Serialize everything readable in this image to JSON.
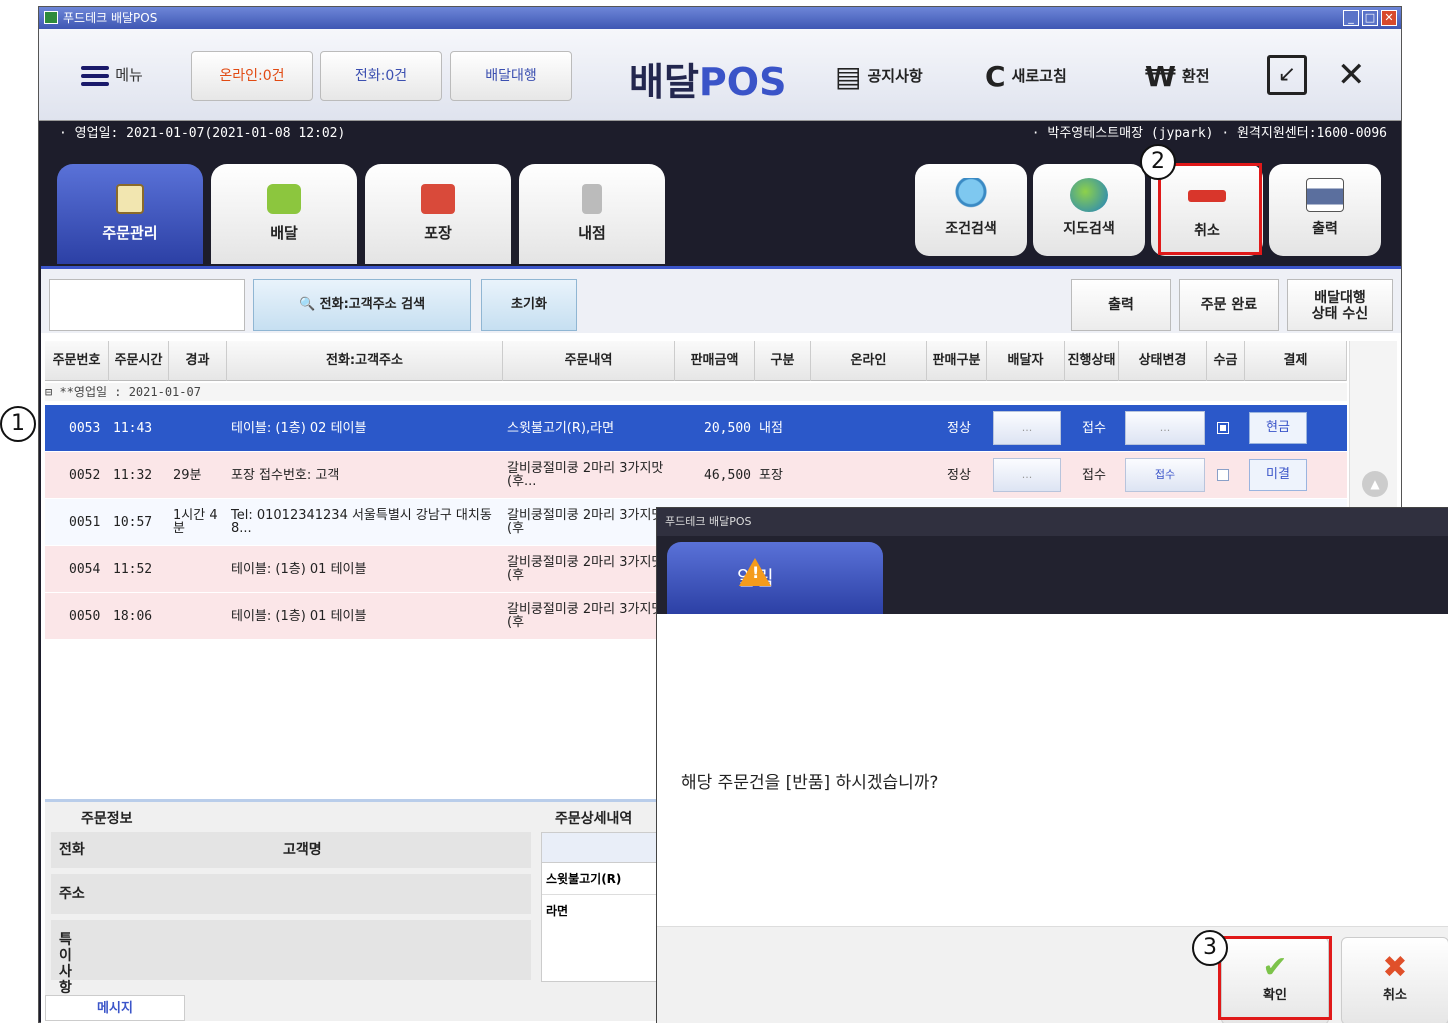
{
  "window": {
    "title": "푸드테크 배달POS"
  },
  "topbar": {
    "menu_label": "메뉴",
    "online_label": "온라인:0건",
    "phone_label": "전화:0건",
    "agent_label": "배달대행",
    "brand_prefix": "배달",
    "brand_suffix": "POS",
    "notice_label": "공지사항",
    "refresh_label": "새로고침",
    "exchange_label": "환전",
    "exchange_icon": "₩",
    "refresh_icon": "C"
  },
  "info": {
    "business_day": "· 영업일: 2021-01-07(2021-01-08 12:02)",
    "store": "· 박주영테스트매장 (jypark)  · 원격지원센터:1600-0096"
  },
  "tabs": [
    {
      "label": "주문관리"
    },
    {
      "label": "배달"
    },
    {
      "label": "포장"
    },
    {
      "label": "내점"
    }
  ],
  "tools": [
    {
      "label": "조건검색"
    },
    {
      "label": "지도검색"
    },
    {
      "label": "취소"
    },
    {
      "label": "출력"
    }
  ],
  "search": {
    "input_value": "",
    "search_button": "전화:고객주소 검색",
    "reset_button": "초기화",
    "print_button": "출력",
    "complete_button": "주문 완료",
    "agent_status_line1": "배달대행",
    "agent_status_line2": "상태 수신"
  },
  "grid": {
    "headers": [
      "주문번호",
      "주문시간",
      "경과",
      "전화:고객주소",
      "주문내역",
      "판매금액",
      "구분",
      "온라인",
      "판매구분",
      "배달자",
      "진행상태",
      "상태변경",
      "수금",
      "결제"
    ],
    "group_label": "⊟ **영업일 : 2021-01-07",
    "rows": [
      {
        "no": "0053",
        "time": "11:43",
        "elapsed": "",
        "addr": "테이블: (1층) 02 테이블",
        "items": "스윗불고기(R),라면",
        "amount": "20,500",
        "type": "내점",
        "online": "",
        "sale": "정상",
        "rider": "...",
        "status": "접수",
        "change": "...",
        "paid": true,
        "pay": "현금"
      },
      {
        "no": "0052",
        "time": "11:32",
        "elapsed": "29분",
        "addr": "포장 접수번호: 고객",
        "items": "갈비쿵절미쿵 2마리 3가지맛(후...",
        "amount": "46,500",
        "type": "포장",
        "online": "",
        "sale": "정상",
        "rider": "...",
        "status": "접수",
        "change": "접수",
        "paid": false,
        "pay": "미결"
      },
      {
        "no": "0051",
        "time": "10:57",
        "elapsed": "1시간 4분",
        "addr": "Tel: 01012341234 서울특별시 강남구 대치동 8...",
        "items": "갈비쿵절미쿵 2마리 3가지맛(후",
        "amount": "",
        "type": "",
        "online": "",
        "sale": "",
        "rider": "",
        "status": "",
        "change": "",
        "paid": false,
        "pay": ""
      },
      {
        "no": "0054",
        "time": "11:52",
        "elapsed": "",
        "addr": "테이블: (1층) 01 테이블",
        "items": "갈비쿵절미쿵 2마리 3가지맛(후",
        "amount": "",
        "type": "",
        "online": "",
        "sale": "",
        "rider": "",
        "status": "",
        "change": "",
        "paid": false,
        "pay": ""
      },
      {
        "no": "0050",
        "time": "18:06",
        "elapsed": "",
        "addr": "테이블: (1층) 01 테이블",
        "items": "갈비쿵절미쿵 2마리 3가지맛(후",
        "amount": "",
        "type": "",
        "online": "",
        "sale": "",
        "rider": "",
        "status": "",
        "change": "",
        "paid": false,
        "pay": ""
      }
    ]
  },
  "bottom": {
    "order_info_title": "주문정보",
    "detail_title": "주문상세내역",
    "phone_label": "전화",
    "customer_label": "고객명",
    "address_label": "주소",
    "note_label": "특이사항",
    "detail_items": [
      "스윗불고기(R)",
      "라면"
    ],
    "message_tab": "메시지"
  },
  "dialog": {
    "title": "푸드테크 배달POS",
    "tab_label": "알림",
    "message": "해당 주문건을 [반품] 하시겠습니까?",
    "ok_label": "확인",
    "cancel_label": "취소"
  },
  "annotations": [
    "1",
    "2",
    "3"
  ],
  "colors": {
    "accent": "#3b55c9",
    "selected_row": "#2b58c9",
    "highlight": "#e01919",
    "warning": "#f49b1c"
  }
}
